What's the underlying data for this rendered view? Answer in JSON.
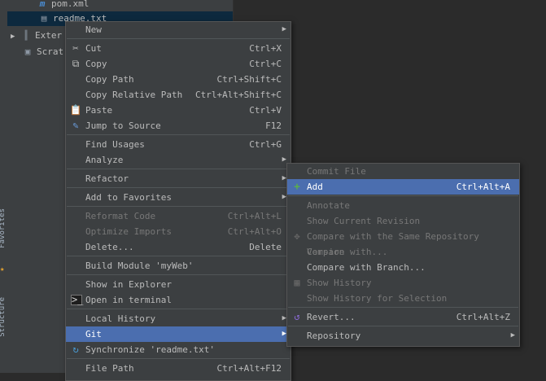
{
  "project_tree": {
    "rows": [
      {
        "label": "pom.xml",
        "icon": "maven-file-icon"
      },
      {
        "label": "readme.txt",
        "icon": "text-file-icon"
      },
      {
        "label": "Exter",
        "icon": "library-icon"
      },
      {
        "label": "Scrat",
        "icon": "scratch-icon"
      }
    ]
  },
  "context_menu": {
    "items": [
      {
        "label": "New",
        "shortcut": ""
      },
      {
        "label": "Cut",
        "shortcut": "Ctrl+X"
      },
      {
        "label": "Copy",
        "shortcut": "Ctrl+C"
      },
      {
        "label": "Copy Path",
        "shortcut": "Ctrl+Shift+C"
      },
      {
        "label": "Copy Relative Path",
        "shortcut": "Ctrl+Alt+Shift+C"
      },
      {
        "label": "Paste",
        "shortcut": "Ctrl+V"
      },
      {
        "label": "Jump to Source",
        "shortcut": "F12"
      },
      {
        "label": "Find Usages",
        "shortcut": "Ctrl+G"
      },
      {
        "label": "Analyze",
        "shortcut": ""
      },
      {
        "label": "Refactor",
        "shortcut": ""
      },
      {
        "label": "Add to Favorites",
        "shortcut": ""
      },
      {
        "label": "Reformat Code",
        "shortcut": "Ctrl+Alt+L"
      },
      {
        "label": "Optimize Imports",
        "shortcut": "Ctrl+Alt+O"
      },
      {
        "label": "Delete...",
        "shortcut": "Delete"
      },
      {
        "label": "Build Module 'myWeb'",
        "shortcut": ""
      },
      {
        "label": "Show in Explorer",
        "shortcut": ""
      },
      {
        "label": "Open in terminal",
        "shortcut": ""
      },
      {
        "label": "Local History",
        "shortcut": ""
      },
      {
        "label": "Git",
        "shortcut": ""
      },
      {
        "label": "Synchronize 'readme.txt'",
        "shortcut": ""
      },
      {
        "label": "File Path",
        "shortcut": "Ctrl+Alt+F12"
      }
    ]
  },
  "git_submenu": {
    "items": [
      {
        "label": "Commit File",
        "shortcut": ""
      },
      {
        "label": "Add",
        "shortcut": "Ctrl+Alt+A"
      },
      {
        "label": "Annotate",
        "shortcut": ""
      },
      {
        "label": "Show Current Revision",
        "shortcut": ""
      },
      {
        "label": "Compare with the Same Repository Version",
        "shortcut": ""
      },
      {
        "label": "Compare with...",
        "shortcut": ""
      },
      {
        "label": "Compare with Branch...",
        "shortcut": ""
      },
      {
        "label": "Show History",
        "shortcut": ""
      },
      {
        "label": "Show History for Selection",
        "shortcut": ""
      },
      {
        "label": "Revert...",
        "shortcut": "Ctrl+Alt+Z"
      },
      {
        "label": "Repository",
        "shortcut": ""
      }
    ]
  },
  "side_strip": {
    "label_1": "Favorites",
    "label_2": "Structure"
  },
  "colors": {
    "highlight": "#4b6eaf",
    "menu_bg": "#3c3f41",
    "editor_bg": "#2b2b2b",
    "selected_tree": "#0d293e"
  }
}
